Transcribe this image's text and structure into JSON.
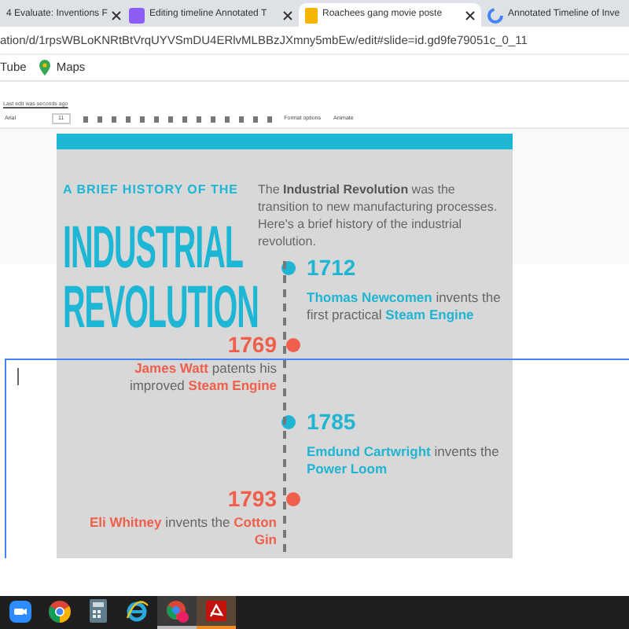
{
  "tabs": [
    {
      "label": "4 Evaluate: Inventions F",
      "kind": "doc",
      "selected": false
    },
    {
      "label": "Editing timeline Annotated T",
      "kind": "tool",
      "selected": false
    },
    {
      "label": "Roachees gang movie poste",
      "kind": "slides",
      "selected": true
    },
    {
      "label": "Annotated Timeline of Inve",
      "kind": "google",
      "selected": false
    }
  ],
  "address": "ation/d/1rpsWBLoKNRtBtVrqUYVSmDU4ERlvMLBBzJXmny5mbEw/edit#slide=id.gd9fe79051c_0_11",
  "bookmarks": [
    {
      "label": "Tube",
      "kind": "plain"
    },
    {
      "label": "Maps",
      "kind": "maps"
    }
  ],
  "last_edit": "Last edit was seconds ago",
  "toolbar": {
    "font": "Arial",
    "size": "11",
    "buttons": [
      "Format options",
      "Animate"
    ]
  },
  "slide": {
    "kicker": "A BRIEF HISTORY OF THE",
    "title": [
      "INDUSTRIAL",
      "REVOLUTION"
    ],
    "intro": "The **Industrial Revolution** was the transition to new manufacturing processes. Here's a brief history of the industrial revolution.",
    "events": [
      {
        "year": "1712",
        "kind": "right",
        "color": "#1fb5d3",
        "text": "**Thomas Newcomen** invents the first practical **Steam Engine**"
      },
      {
        "year": "1769",
        "kind": "left",
        "color": "#ef5f4b",
        "text": "**James Watt** patents his improved **Steam Engine**"
      },
      {
        "year": "1785",
        "kind": "right",
        "color": "#1fb5d3",
        "text": "**Emdund Cartwright** invents the **Power Loom**"
      },
      {
        "year": "1793",
        "kind": "left",
        "color": "#ef5f4b",
        "text": "**Eli Whitney** invents the **Cotton Gin**"
      }
    ]
  },
  "taskbar": [
    {
      "kind": "zoom",
      "open": false,
      "selected": false
    },
    {
      "kind": "chrome",
      "open": false,
      "selected": false
    },
    {
      "kind": "calculator",
      "open": false,
      "selected": false
    },
    {
      "kind": "ie",
      "open": false,
      "selected": false
    },
    {
      "kind": "chrome-profile",
      "open": true,
      "selected": false
    },
    {
      "kind": "acrobat",
      "open": true,
      "selected": true
    }
  ]
}
